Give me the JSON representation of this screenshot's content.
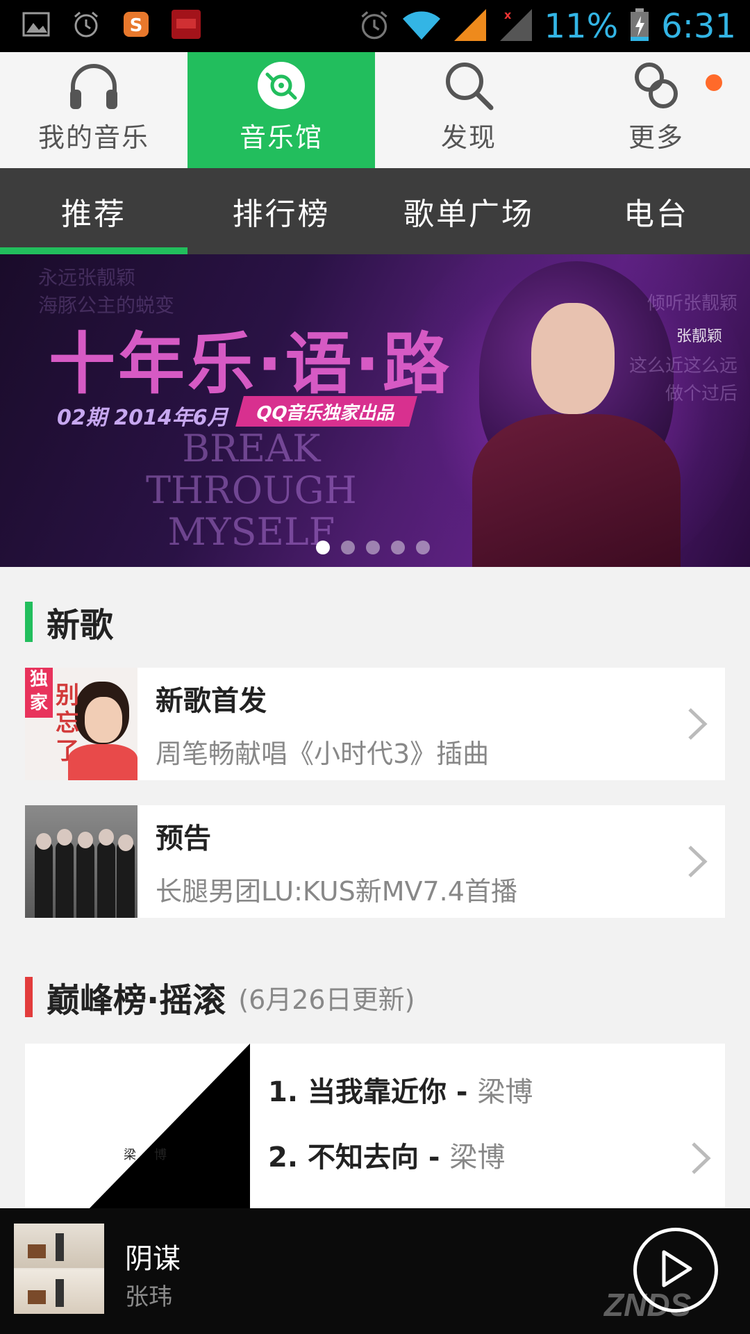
{
  "status_bar": {
    "battery_percent": "11%",
    "time": "6:31",
    "left_icons": [
      "gallery-icon",
      "alarm-icon",
      "sogou-icon",
      "netease-icon"
    ],
    "right_icons": [
      "alarm-icon",
      "wifi-icon",
      "signal-icon",
      "signal-icon",
      "battery-icon"
    ],
    "accent_color": "#33b5e5"
  },
  "top_nav": {
    "items": [
      {
        "label": "我的音乐",
        "icon": "headphones-icon"
      },
      {
        "label": "音乐馆",
        "icon": "disc-icon",
        "active": true
      },
      {
        "label": "发现",
        "icon": "search-icon"
      },
      {
        "label": "更多",
        "icon": "more-icon",
        "badge": true
      }
    ],
    "active_color": "#22be5d"
  },
  "sub_tabs": {
    "items": [
      "推荐",
      "排行榜",
      "歌单广场",
      "电台"
    ],
    "active_index": 0
  },
  "banner": {
    "title": "十年乐·语·路",
    "issue": "02期  2014年6月",
    "tag": "QQ音乐独家出品",
    "english": [
      "BREAK",
      "THROUGH",
      "MYSELF"
    ],
    "signature": "张靓颖",
    "ghost_left": [
      "永远张靓颖",
      "海豚公主的蜕变"
    ],
    "ghost_right": [
      "倾听张靓颖",
      "这么近这么远",
      "做个过后"
    ],
    "page_count": 5,
    "current_page": 1
  },
  "new_songs": {
    "title": "新歌",
    "items": [
      {
        "title": "新歌首发",
        "subtitle": "周笔畅献唱《小时代3》插曲",
        "thumb_badge": "独家",
        "thumb_text": "别忘了"
      },
      {
        "title": "预告",
        "subtitle": "长腿男团LU:KUS新MV7.4首播"
      }
    ]
  },
  "chart": {
    "title": "巅峰榜·摇滚",
    "update": "(6月26日更新)",
    "cover_artist": "梁博",
    "rows": [
      {
        "rank": "1.",
        "song": "当我靠近你",
        "sep": " - ",
        "artist": "梁博"
      },
      {
        "rank": "2.",
        "song": "不知去向",
        "sep": " - ",
        "artist": "梁博"
      }
    ]
  },
  "player": {
    "song": "阴谋",
    "artist": "张玮",
    "watermark": "ZNDS"
  }
}
